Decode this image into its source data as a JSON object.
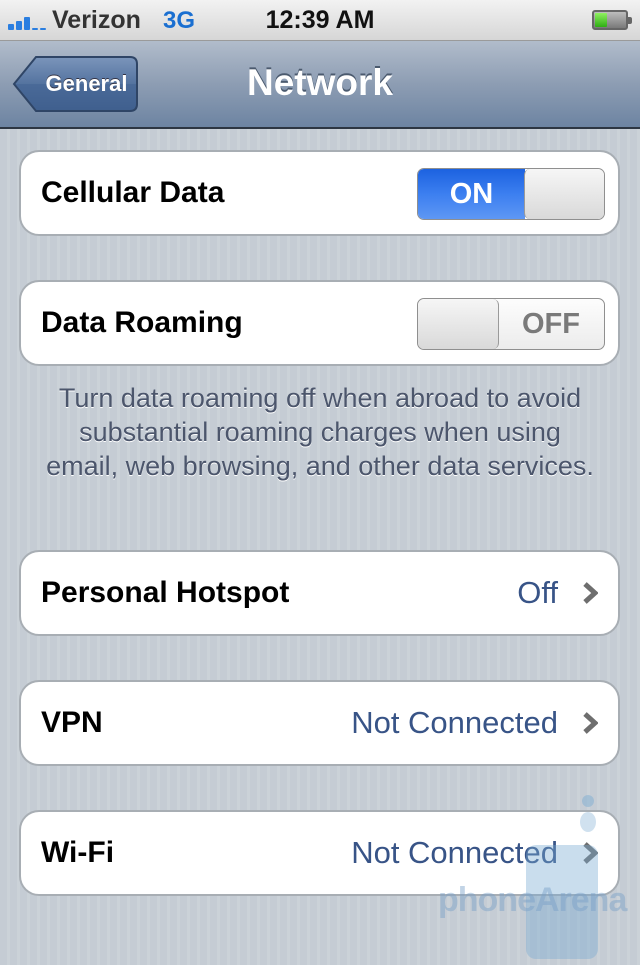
{
  "status_bar": {
    "signal_bars_filled": 3,
    "signal_bars_total": 5,
    "carrier": "Verizon",
    "network_type": "3G",
    "time": "12:39 AM",
    "battery_level": 0.4
  },
  "nav_bar": {
    "back_label": "General",
    "title": "Network"
  },
  "cells": {
    "cellular_data": {
      "label": "Cellular Data",
      "toggle_state": "on",
      "toggle_label": "ON"
    },
    "data_roaming": {
      "label": "Data Roaming",
      "toggle_state": "off",
      "toggle_label": "OFF"
    },
    "roaming_note": "Turn data roaming off when abroad to avoid substantial roaming charges when using email, web browsing, and other data services.",
    "personal_hotspot": {
      "label": "Personal Hotspot",
      "value": "Off"
    },
    "vpn": {
      "label": "VPN",
      "value": "Not Connected"
    },
    "wifi": {
      "label": "Wi-Fi",
      "value": "Not Connected"
    }
  },
  "watermark": {
    "text": "phoneArena"
  },
  "colors": {
    "toggle_on": "#3c7ff0",
    "value_text": "#385487",
    "nav_bar": "#8d9db3",
    "background": "#c5ccd4"
  }
}
